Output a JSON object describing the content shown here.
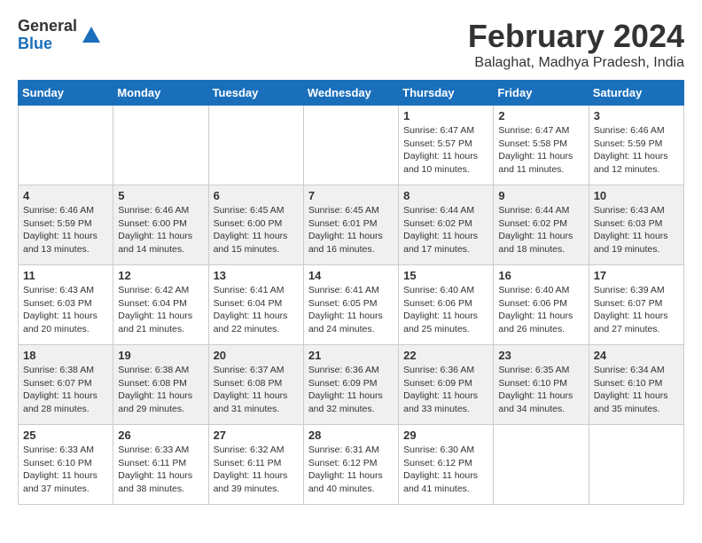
{
  "logo": {
    "general": "General",
    "blue": "Blue"
  },
  "title": {
    "month": "February 2024",
    "location": "Balaghat, Madhya Pradesh, India"
  },
  "headers": [
    "Sunday",
    "Monday",
    "Tuesday",
    "Wednesday",
    "Thursday",
    "Friday",
    "Saturday"
  ],
  "weeks": [
    {
      "shaded": false,
      "days": [
        {
          "num": "",
          "info": ""
        },
        {
          "num": "",
          "info": ""
        },
        {
          "num": "",
          "info": ""
        },
        {
          "num": "",
          "info": ""
        },
        {
          "num": "1",
          "info": "Sunrise: 6:47 AM\nSunset: 5:57 PM\nDaylight: 11 hours\nand 10 minutes."
        },
        {
          "num": "2",
          "info": "Sunrise: 6:47 AM\nSunset: 5:58 PM\nDaylight: 11 hours\nand 11 minutes."
        },
        {
          "num": "3",
          "info": "Sunrise: 6:46 AM\nSunset: 5:59 PM\nDaylight: 11 hours\nand 12 minutes."
        }
      ]
    },
    {
      "shaded": true,
      "days": [
        {
          "num": "4",
          "info": "Sunrise: 6:46 AM\nSunset: 5:59 PM\nDaylight: 11 hours\nand 13 minutes."
        },
        {
          "num": "5",
          "info": "Sunrise: 6:46 AM\nSunset: 6:00 PM\nDaylight: 11 hours\nand 14 minutes."
        },
        {
          "num": "6",
          "info": "Sunrise: 6:45 AM\nSunset: 6:00 PM\nDaylight: 11 hours\nand 15 minutes."
        },
        {
          "num": "7",
          "info": "Sunrise: 6:45 AM\nSunset: 6:01 PM\nDaylight: 11 hours\nand 16 minutes."
        },
        {
          "num": "8",
          "info": "Sunrise: 6:44 AM\nSunset: 6:02 PM\nDaylight: 11 hours\nand 17 minutes."
        },
        {
          "num": "9",
          "info": "Sunrise: 6:44 AM\nSunset: 6:02 PM\nDaylight: 11 hours\nand 18 minutes."
        },
        {
          "num": "10",
          "info": "Sunrise: 6:43 AM\nSunset: 6:03 PM\nDaylight: 11 hours\nand 19 minutes."
        }
      ]
    },
    {
      "shaded": false,
      "days": [
        {
          "num": "11",
          "info": "Sunrise: 6:43 AM\nSunset: 6:03 PM\nDaylight: 11 hours\nand 20 minutes."
        },
        {
          "num": "12",
          "info": "Sunrise: 6:42 AM\nSunset: 6:04 PM\nDaylight: 11 hours\nand 21 minutes."
        },
        {
          "num": "13",
          "info": "Sunrise: 6:41 AM\nSunset: 6:04 PM\nDaylight: 11 hours\nand 22 minutes."
        },
        {
          "num": "14",
          "info": "Sunrise: 6:41 AM\nSunset: 6:05 PM\nDaylight: 11 hours\nand 24 minutes."
        },
        {
          "num": "15",
          "info": "Sunrise: 6:40 AM\nSunset: 6:06 PM\nDaylight: 11 hours\nand 25 minutes."
        },
        {
          "num": "16",
          "info": "Sunrise: 6:40 AM\nSunset: 6:06 PM\nDaylight: 11 hours\nand 26 minutes."
        },
        {
          "num": "17",
          "info": "Sunrise: 6:39 AM\nSunset: 6:07 PM\nDaylight: 11 hours\nand 27 minutes."
        }
      ]
    },
    {
      "shaded": true,
      "days": [
        {
          "num": "18",
          "info": "Sunrise: 6:38 AM\nSunset: 6:07 PM\nDaylight: 11 hours\nand 28 minutes."
        },
        {
          "num": "19",
          "info": "Sunrise: 6:38 AM\nSunset: 6:08 PM\nDaylight: 11 hours\nand 29 minutes."
        },
        {
          "num": "20",
          "info": "Sunrise: 6:37 AM\nSunset: 6:08 PM\nDaylight: 11 hours\nand 31 minutes."
        },
        {
          "num": "21",
          "info": "Sunrise: 6:36 AM\nSunset: 6:09 PM\nDaylight: 11 hours\nand 32 minutes."
        },
        {
          "num": "22",
          "info": "Sunrise: 6:36 AM\nSunset: 6:09 PM\nDaylight: 11 hours\nand 33 minutes."
        },
        {
          "num": "23",
          "info": "Sunrise: 6:35 AM\nSunset: 6:10 PM\nDaylight: 11 hours\nand 34 minutes."
        },
        {
          "num": "24",
          "info": "Sunrise: 6:34 AM\nSunset: 6:10 PM\nDaylight: 11 hours\nand 35 minutes."
        }
      ]
    },
    {
      "shaded": false,
      "days": [
        {
          "num": "25",
          "info": "Sunrise: 6:33 AM\nSunset: 6:10 PM\nDaylight: 11 hours\nand 37 minutes."
        },
        {
          "num": "26",
          "info": "Sunrise: 6:33 AM\nSunset: 6:11 PM\nDaylight: 11 hours\nand 38 minutes."
        },
        {
          "num": "27",
          "info": "Sunrise: 6:32 AM\nSunset: 6:11 PM\nDaylight: 11 hours\nand 39 minutes."
        },
        {
          "num": "28",
          "info": "Sunrise: 6:31 AM\nSunset: 6:12 PM\nDaylight: 11 hours\nand 40 minutes."
        },
        {
          "num": "29",
          "info": "Sunrise: 6:30 AM\nSunset: 6:12 PM\nDaylight: 11 hours\nand 41 minutes."
        },
        {
          "num": "",
          "info": ""
        },
        {
          "num": "",
          "info": ""
        }
      ]
    }
  ]
}
